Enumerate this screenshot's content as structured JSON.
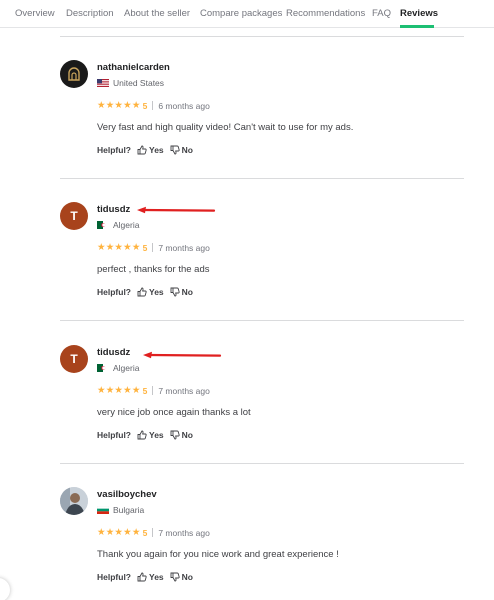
{
  "tabs": [
    {
      "label": "Overview",
      "active": false
    },
    {
      "label": "Description",
      "active": false
    },
    {
      "label": "About the seller",
      "active": false
    },
    {
      "label": "Compare packages",
      "active": false
    },
    {
      "label": "Recommendations",
      "active": false
    },
    {
      "label": "FAQ",
      "active": false
    },
    {
      "label": "Reviews",
      "active": true
    }
  ],
  "colors": {
    "accent": "#1dbf73",
    "star": "#ffb33e",
    "avatar_letter_bg": "#a8431c",
    "arrow": "#e02020"
  },
  "reviews": [
    {
      "username": "nathanielcarden",
      "avatar": "dark-logo",
      "country": "United States",
      "stars": "★★★★★",
      "rating": "5",
      "time_ago": "6 months ago",
      "comment": "Very fast and high quality video! Can't wait to use for my ads.",
      "helpful_label": "Helpful?",
      "yes_label": "Yes",
      "no_label": "No"
    },
    {
      "username": "tidusdz",
      "avatar_letter": "T",
      "country": "Algeria",
      "stars": "★★★★★",
      "rating": "5",
      "time_ago": "7 months ago",
      "comment": "perfect , thanks for the ads",
      "helpful_label": "Helpful?",
      "yes_label": "Yes",
      "no_label": "No"
    },
    {
      "username": "tidusdz",
      "avatar_letter": "T",
      "country": "Algeria",
      "stars": "★★★★★",
      "rating": "5",
      "time_ago": "7 months ago",
      "comment": "very nice job once again thanks a lot",
      "helpful_label": "Helpful?",
      "yes_label": "Yes",
      "no_label": "No"
    },
    {
      "username": "vasilboychev",
      "avatar": "photo",
      "country": "Bulgaria",
      "stars": "★★★★★",
      "rating": "5",
      "time_ago": "7 months ago",
      "comment": "Thank you again for you nice work and great experience !",
      "helpful_label": "Helpful?",
      "yes_label": "Yes",
      "no_label": "No"
    }
  ]
}
